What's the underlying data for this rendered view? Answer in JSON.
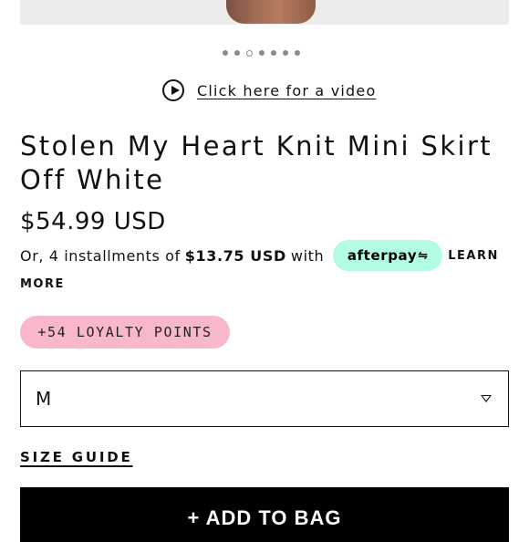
{
  "carousel": {
    "dot_count": 7,
    "active_index": 2
  },
  "video": {
    "link_text": "Click here for a video",
    "icon": "play-circle-icon"
  },
  "product": {
    "title_line1": "Stolen My Heart Knit Mini Skirt",
    "title_line2": "Off White",
    "price": "$54.99 USD"
  },
  "installments": {
    "prefix": "Or, 4 installments of",
    "amount": "$13.75 USD",
    "with": "with",
    "provider": "afterpay",
    "provider_icon": "afterpay-loop-icon",
    "learn": "LEARN",
    "more": "MORE",
    "badge_color": "#b2fce4"
  },
  "loyalty": {
    "label": "+54 LOYALTY POINTS",
    "color": "#f8b8ca"
  },
  "size_select": {
    "selected": "M",
    "icon": "chevron-down-icon"
  },
  "size_guide": {
    "label": "SIZE GUIDE"
  },
  "cart": {
    "add_label": "+ ADD TO BAG"
  }
}
